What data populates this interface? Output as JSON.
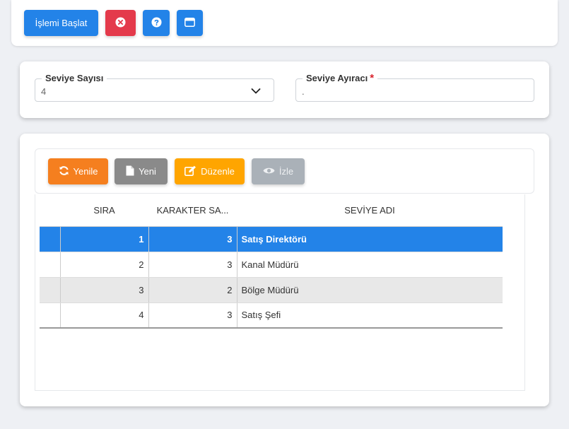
{
  "toolbar": {
    "start_label": "İşlemi Başlat"
  },
  "settings": {
    "level_count": {
      "label": "Seviye Sayısı",
      "value": "4"
    },
    "separator": {
      "label": "Seviye Ayıracı",
      "required_mark": "*",
      "value": "."
    }
  },
  "grid_toolbar": {
    "refresh_label": "Yenile",
    "new_label": "Yeni",
    "edit_label": "Düzenle",
    "watch_label": "İzle"
  },
  "grid": {
    "columns": [
      "SIRA",
      "KARAKTER SA...",
      "SEVİYE ADI"
    ],
    "rows": [
      {
        "sira": "1",
        "karakter": "3",
        "ad": "Satış Direktörü"
      },
      {
        "sira": "2",
        "karakter": "3",
        "ad": "Kanal Müdürü"
      },
      {
        "sira": "3",
        "karakter": "2",
        "ad": "Bölge Müdürü"
      },
      {
        "sira": "4",
        "karakter": "3",
        "ad": "Satış Şefi"
      }
    ]
  },
  "colors": {
    "primary": "#2383e8",
    "danger": "#e43a4b",
    "orange": "#f57f1f",
    "gray": "#8a8a8a",
    "amber": "#ffa500",
    "disabled": "#aab1b8"
  }
}
